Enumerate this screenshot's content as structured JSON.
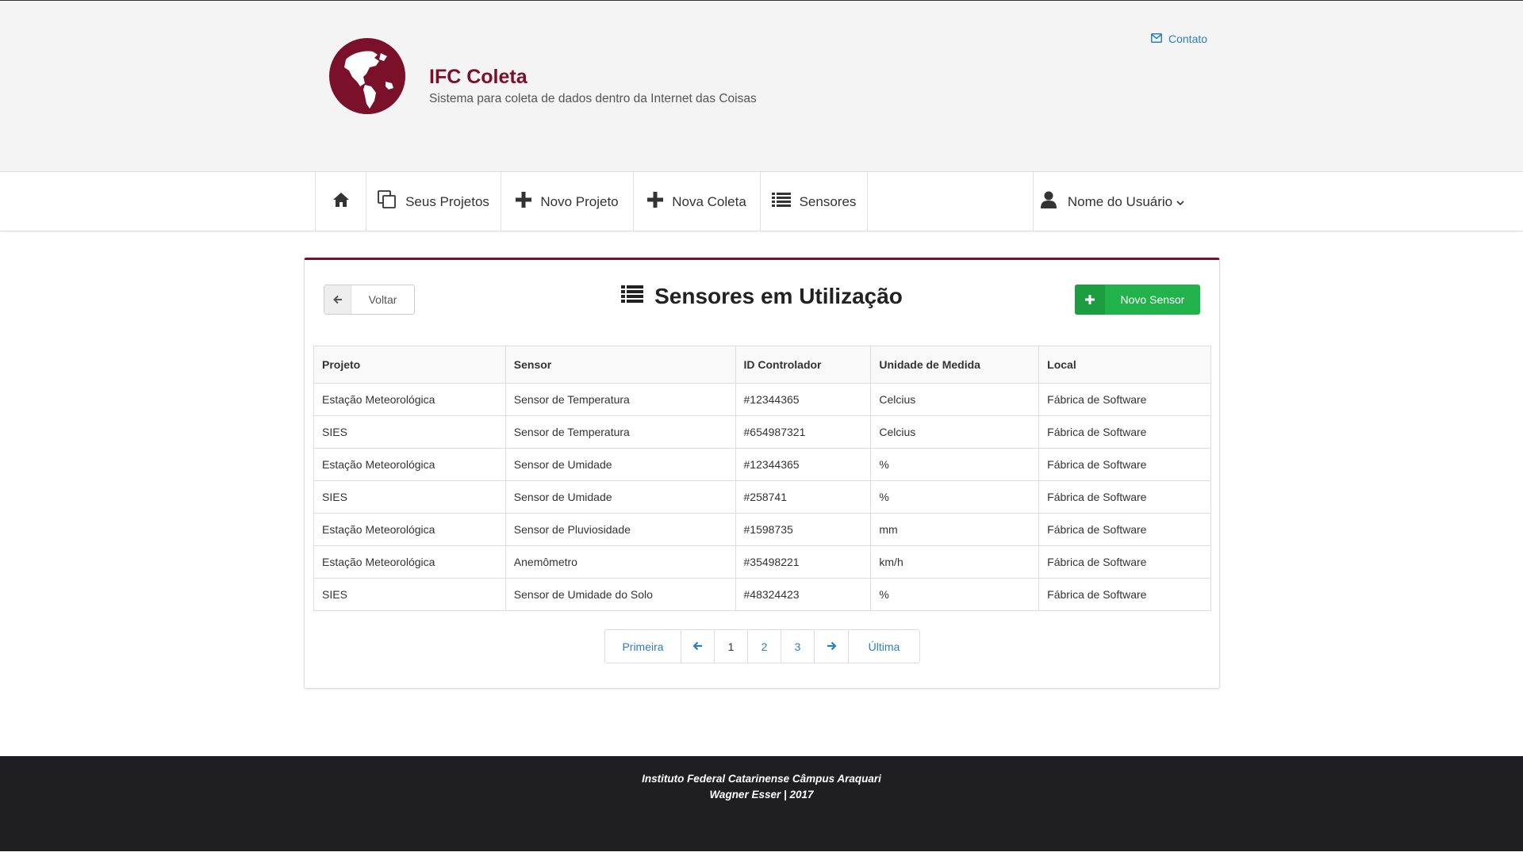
{
  "colors": {
    "brand": "#7a1029",
    "accent": "#2a7fc1",
    "success": "#22b24c",
    "footer": "#1f1f21"
  },
  "header": {
    "title": "IFC Coleta",
    "subtitle": "Sistema para coleta de dados dentro da Internet das Coisas",
    "logo_icon": "globe-americas-icon",
    "contact": {
      "icon": "envelope-icon",
      "label": "Contato"
    }
  },
  "nav": {
    "home_icon": "home-icon",
    "items": [
      {
        "icon": "copy-icon",
        "label": "Seus Projetos"
      },
      {
        "icon": "plus-icon",
        "label": "Novo Projeto"
      },
      {
        "icon": "plus-icon",
        "label": "Nova Coleta"
      },
      {
        "icon": "list-icon",
        "label": "Sensores"
      }
    ],
    "user": {
      "icon": "user-icon",
      "label": "Nome do Usuário",
      "caret": "chevron-down-icon"
    }
  },
  "page": {
    "title": "Sensores em Utilização",
    "title_icon": "list-icon",
    "back_button": {
      "icon": "arrow-left-icon",
      "label": "Voltar"
    },
    "new_button": {
      "icon": "plus-icon",
      "label": "Novo Sensor"
    }
  },
  "table": {
    "columns": [
      "Projeto",
      "Sensor",
      "ID Controlador",
      "Unidade de Medida",
      "Local"
    ],
    "rows": [
      [
        "Estação Meteorológica",
        "Sensor de Temperatura",
        "#12344365",
        "Celcius",
        "Fábrica de Software"
      ],
      [
        "SIES",
        "Sensor de Temperatura",
        "#654987321",
        "Celcius",
        "Fábrica de Software"
      ],
      [
        "Estação Meteorológica",
        "Sensor de Umidade",
        "#12344365",
        "%",
        "Fábrica de Software"
      ],
      [
        "SIES",
        "Sensor de Umidade",
        "#258741",
        "%",
        "Fábrica de Software"
      ],
      [
        "Estação Meteorológica",
        "Sensor de Pluviosidade",
        "#1598735",
        "mm",
        "Fábrica de Software"
      ],
      [
        "Estação Meteorológica",
        "Anemômetro",
        "#35498221",
        "km/h",
        "Fábrica de Software"
      ],
      [
        "SIES",
        "Sensor de Umidade do Solo",
        "#48324423",
        "%",
        "Fábrica de Software"
      ]
    ]
  },
  "pagination": {
    "first": "Primeira",
    "prev_icon": "arrow-left-icon",
    "pages": [
      "1",
      "2",
      "3"
    ],
    "current": "1",
    "next_icon": "arrow-right-icon",
    "last": "Última"
  },
  "footer": {
    "line1": "Instituto Federal Catarinense Câmpus Araquari",
    "line2": "Wagner Esser | 2017"
  }
}
